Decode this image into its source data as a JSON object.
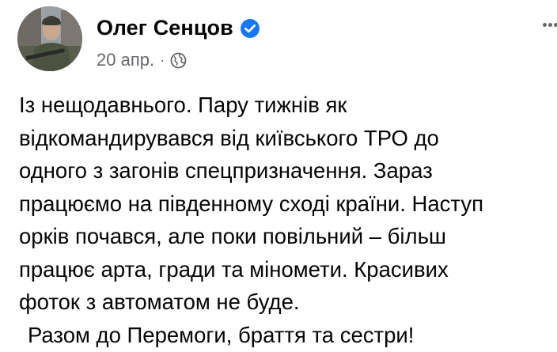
{
  "post": {
    "author": "Олег Сенцов",
    "verified": true,
    "timestamp": "20 апр.",
    "separator": "·",
    "audience_icon": "globe-icon",
    "more_icon": "more-options-icon",
    "lines": [
      "Із нещодавнього. Пару тижнів як",
      "відкомандирувався від київського ТРО до",
      "одного з загонів спецпризначення. Зараз",
      "працюємо на південному сході країни. Наступ",
      "орків почався, але поки повільний – більш",
      "працює арта, гради та міномети. Красивих",
      "фоток з автоматом не буде.",
      "Разом до Перемоги, браття та сестри!"
    ]
  },
  "colors": {
    "text": "#050505",
    "meta": "#65676b",
    "verified_badge": "#1877f2"
  }
}
